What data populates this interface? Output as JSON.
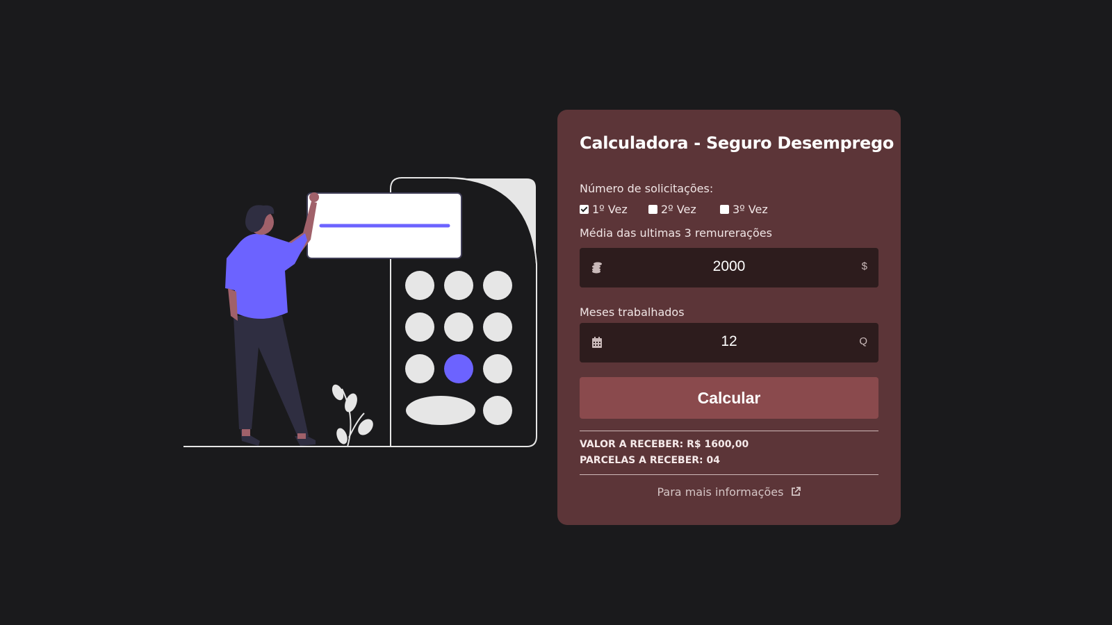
{
  "card": {
    "title": "Calculadora - Seguro Desemprego",
    "requests_label": "Número de solicitações:",
    "options": [
      {
        "label": "1º Vez",
        "checked": true
      },
      {
        "label": "2º Vez",
        "checked": false
      },
      {
        "label": "3º Vez",
        "checked": false
      }
    ],
    "salary_label": "Média das ultimas 3 remurerações",
    "salary_value": "2000",
    "salary_suffix": "$",
    "salary_icon": "coins-icon",
    "months_label": "Meses trabalhados",
    "months_value": "12",
    "months_suffix": "Q",
    "months_icon": "calendar-icon",
    "button_label": "Calcular",
    "result_value": "VALOR A RECEBER: R$ 1600,00",
    "result_installments": "PARCELAS A RECEBER: 04",
    "more_info": "Para mais informações",
    "more_info_icon": "external-link-icon"
  },
  "colors": {
    "background": "#1a1a1c",
    "card": "#5c3538",
    "field": "#2d1c1d",
    "button": "#8a4a4d",
    "accent": "#6c63ff"
  }
}
